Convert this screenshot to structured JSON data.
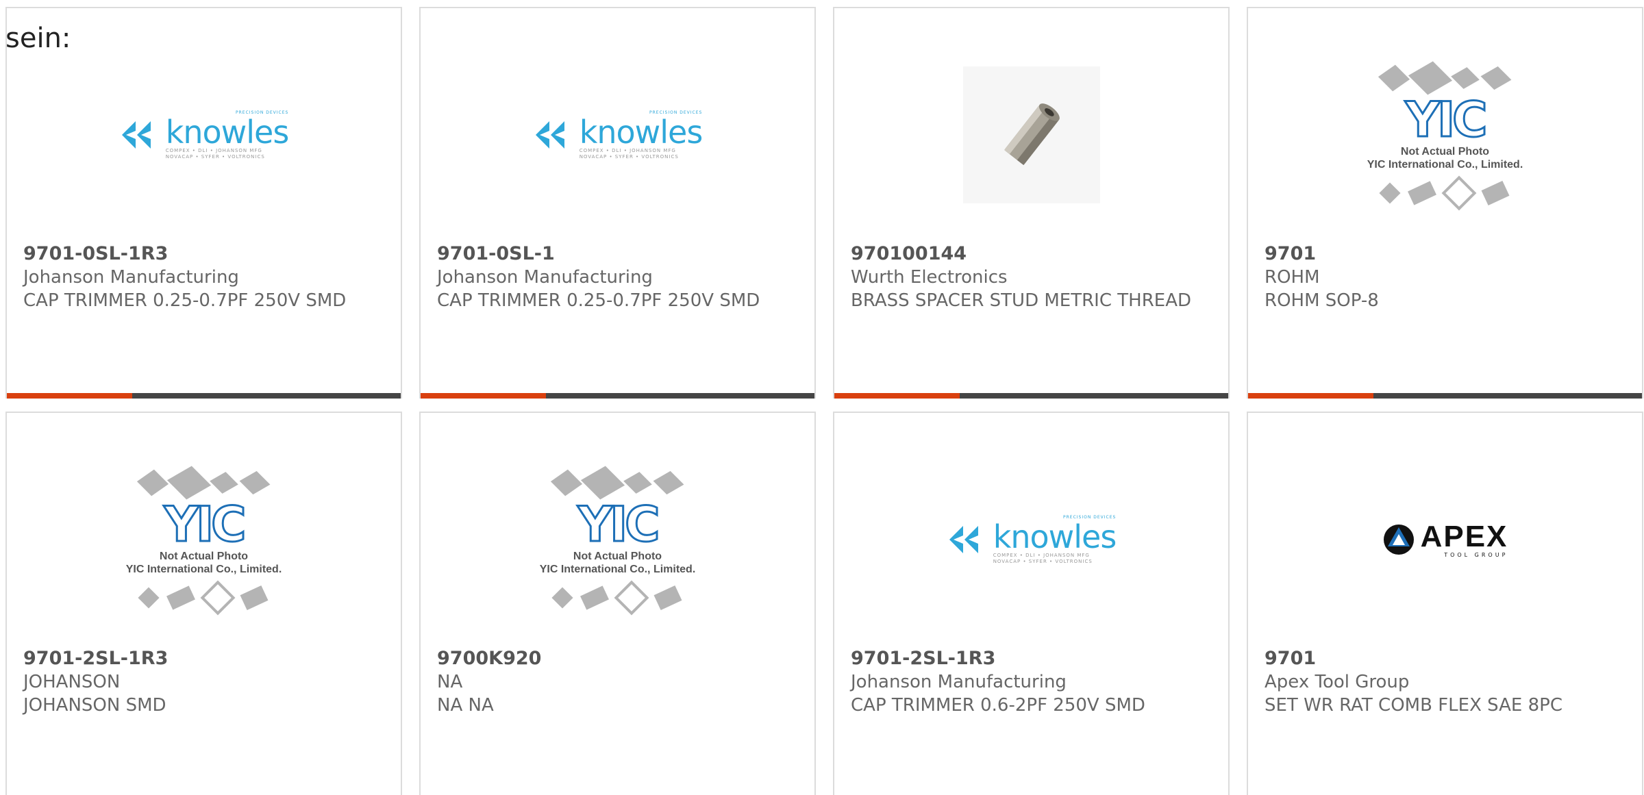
{
  "intro_text": "sein:",
  "colors": {
    "accent": "#d9400f",
    "bar": "#454545",
    "knowles_blue": "#2ea7d9",
    "yic_blue": "#1d6fb6"
  },
  "products": [
    {
      "part": "9701-0SL-1R3",
      "maker": "Johanson Manufacturing",
      "desc": "CAP TRIMMER 0.25-0.7PF 250V SMD",
      "image": "knowles-logo"
    },
    {
      "part": "9701-0SL-1",
      "maker": "Johanson Manufacturing",
      "desc": "CAP TRIMMER 0.25-0.7PF 250V SMD",
      "image": "knowles-logo"
    },
    {
      "part": "970100144",
      "maker": "Wurth Electronics",
      "desc": "BRASS SPACER STUD METRIC THREAD",
      "image": "brass-spacer-photo"
    },
    {
      "part": "9701",
      "maker": "ROHM",
      "desc": "ROHM SOP-8",
      "image": "yic-placeholder"
    },
    {
      "part": "9701-2SL-1R3",
      "maker": "JOHANSON",
      "desc": "JOHANSON SMD",
      "image": "yic-placeholder"
    },
    {
      "part": "9700K920",
      "maker": "NA",
      "desc": "NA NA",
      "image": "yic-placeholder"
    },
    {
      "part": "9701-2SL-1R3",
      "maker": "Johanson Manufacturing",
      "desc": "CAP TRIMMER 0.6-2PF 250V SMD",
      "image": "knowles-logo"
    },
    {
      "part": "9701",
      "maker": "Apex Tool Group",
      "desc": "SET WR RAT COMB FLEX SAE 8PC",
      "image": "apex-logo"
    }
  ],
  "logos": {
    "knowles": {
      "word": "knowles",
      "tagline": "PRECISION DEVICES",
      "sub1": "COMPEX • DLI • JOHANSON MFG",
      "sub2": "NOVACAP • SYFER • VOLTRONICS"
    },
    "yic": {
      "logo": "YIC",
      "caption1": "Not Actual Photo",
      "caption2": "YIC International Co., Limited."
    },
    "apex": {
      "word": "APEX",
      "sub": "TOOL GROUP"
    }
  }
}
